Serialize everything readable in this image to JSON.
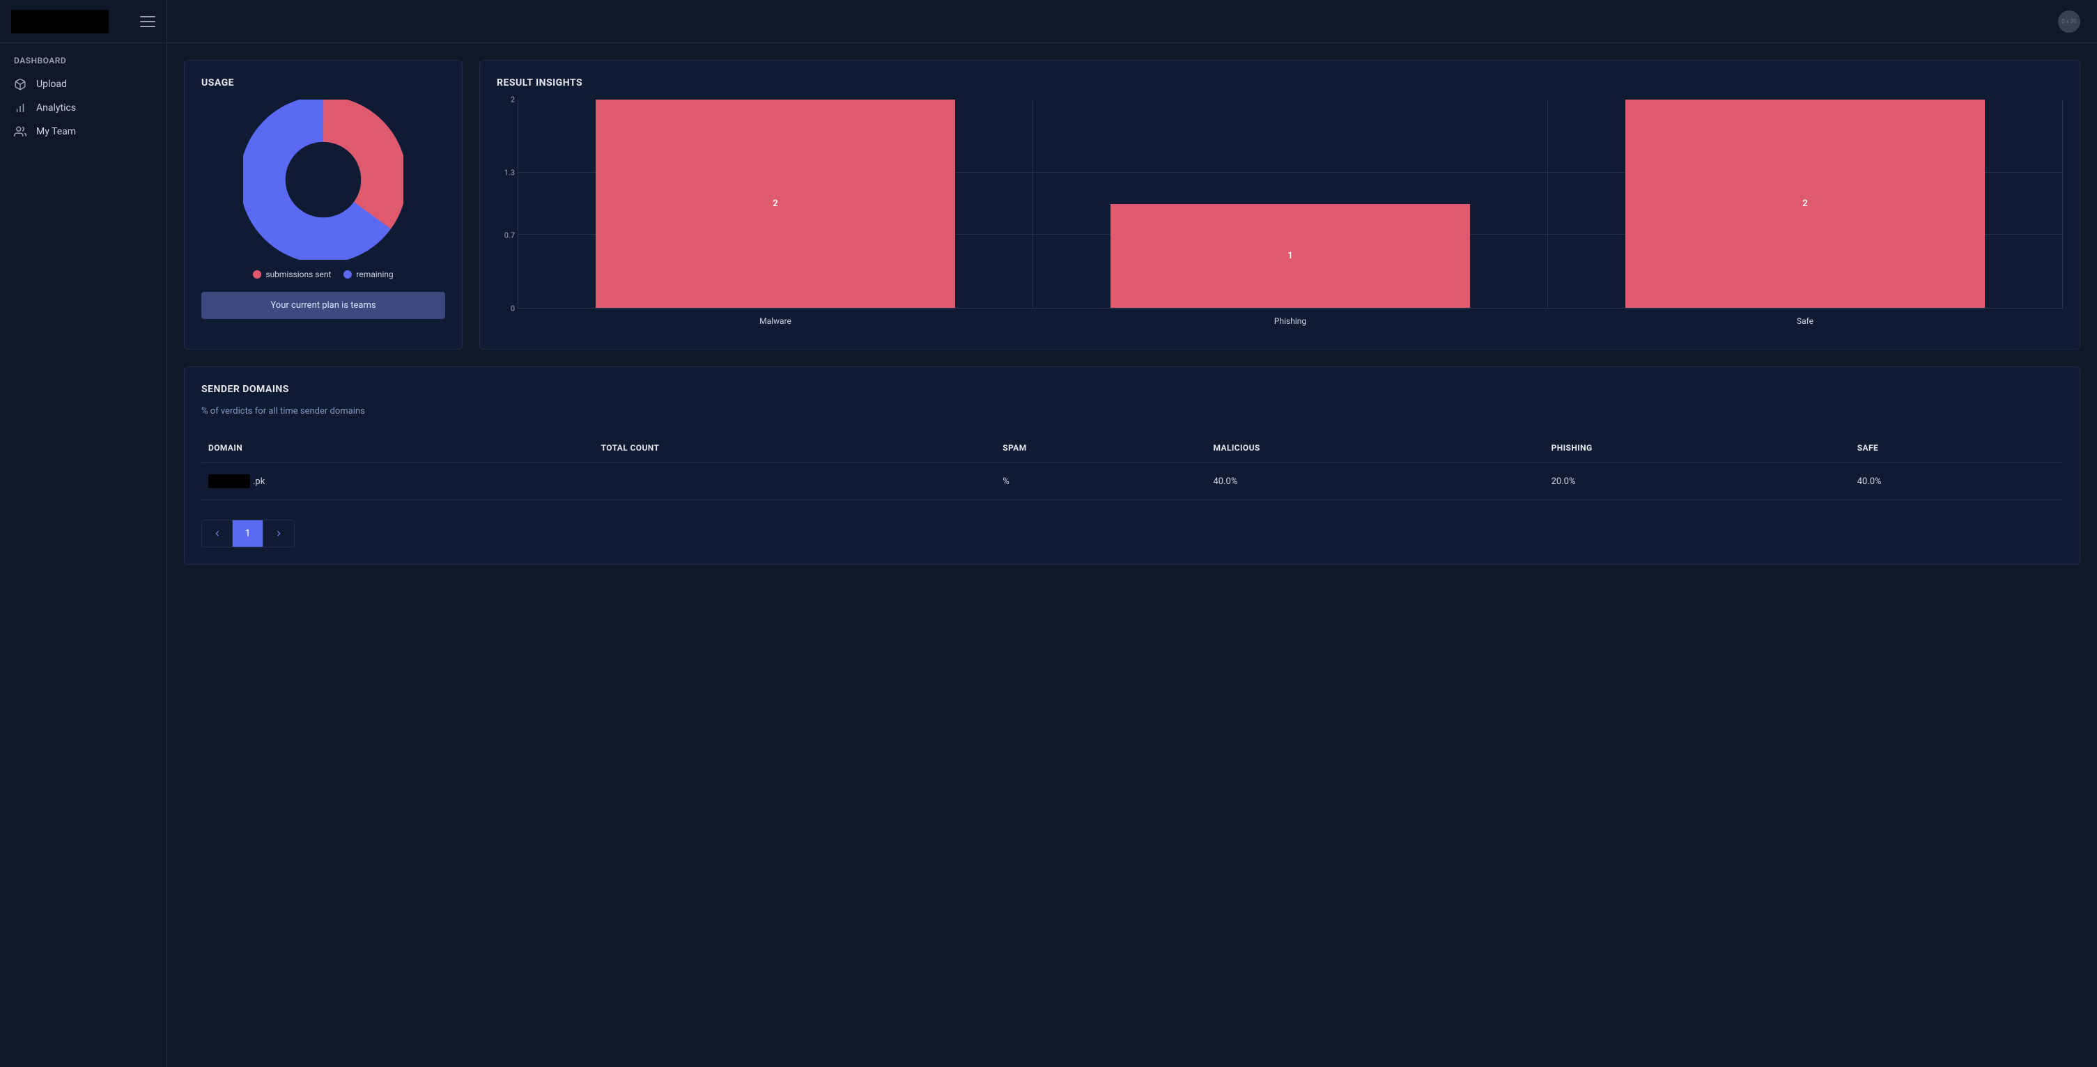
{
  "sidebar": {
    "heading": "DASHBOARD",
    "items": [
      {
        "label": "Upload",
        "icon": "cube-icon"
      },
      {
        "label": "Analytics",
        "icon": "bar-chart-icon"
      },
      {
        "label": "My Team",
        "icon": "users-icon"
      }
    ]
  },
  "avatar": {
    "placeholder": "0 x 30"
  },
  "usage": {
    "title": "USAGE",
    "legend": {
      "submissions": "submissions sent",
      "remaining": "remaining"
    },
    "plan_text": "Your current plan is teams",
    "colors": {
      "submissions": "#e05a6e",
      "remaining": "#5b6af2"
    }
  },
  "insights": {
    "title": "RESULT INSIGHTS"
  },
  "sender_domains": {
    "title": "SENDER DOMAINS",
    "subtitle": "% of verdicts for all time sender domains",
    "columns": {
      "domain": "DOMAIN",
      "total": "TOTAL COUNT",
      "spam": "SPAM",
      "malicious": "MALICIOUS",
      "phishing": "PHISHING",
      "safe": "SAFE"
    },
    "rows": [
      {
        "domain_suffix": ".pk",
        "total": "",
        "spam": "%",
        "malicious": "40.0%",
        "phishing": "20.0%",
        "safe": "40.0%"
      }
    ],
    "pager": {
      "current": "1"
    }
  },
  "chart_data": [
    {
      "type": "pie",
      "title": "USAGE",
      "series": [
        {
          "name": "submissions sent",
          "value": 35,
          "color": "#e05a6e"
        },
        {
          "name": "remaining",
          "value": 65,
          "color": "#5b6af2"
        }
      ],
      "note": "Values estimated from arc length; donut chart with inner hole."
    },
    {
      "type": "bar",
      "title": "RESULT INSIGHTS",
      "categories": [
        "Malware",
        "Phishing",
        "Safe"
      ],
      "values": [
        2,
        1,
        2
      ],
      "xlabel": "",
      "ylabel": "",
      "ylim": [
        0.0,
        2.0
      ],
      "yticks": [
        0.0,
        0.7,
        1.3,
        2.0
      ],
      "bar_color": "#e05a6e"
    }
  ]
}
